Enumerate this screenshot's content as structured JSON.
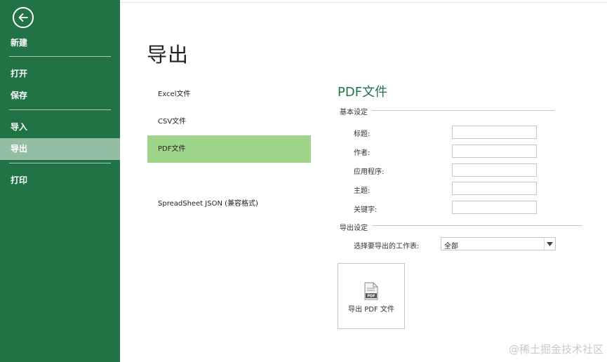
{
  "sidebar": {
    "items": [
      {
        "label": "新建",
        "active": false
      },
      {
        "label": "打开",
        "active": false
      },
      {
        "label": "保存",
        "active": false
      },
      {
        "label": "导入",
        "active": false
      },
      {
        "label": "导出",
        "active": true
      },
      {
        "label": "打印",
        "active": false
      }
    ]
  },
  "colors": {
    "sidebar_bg": "#217346",
    "active_nav": "#93bea4",
    "active_format": "#9fd58a",
    "accent_text": "#217346"
  },
  "page_title": "导出",
  "formats": [
    {
      "label": "Excel文件",
      "active": false
    },
    {
      "label": "CSV文件",
      "active": false
    },
    {
      "label": "PDF文件",
      "active": true
    },
    {
      "label": "SpreadSheet JSON (兼容格式)",
      "active": false
    }
  ],
  "pdf_panel": {
    "title": "PDF文件",
    "basic_heading": "基本设定",
    "fields": [
      {
        "label": "标题:",
        "value": ""
      },
      {
        "label": "作者:",
        "value": ""
      },
      {
        "label": "应用程序:",
        "value": ""
      },
      {
        "label": "主题:",
        "value": ""
      },
      {
        "label": "关键字:",
        "value": ""
      }
    ],
    "export_heading": "导出设定",
    "sheet_label": "选择要导出的工作表:",
    "sheet_value": "全部",
    "export_button": "导出 PDF 文件",
    "icon_caption": "PDF"
  },
  "watermark": "@稀土掘金技术社区"
}
